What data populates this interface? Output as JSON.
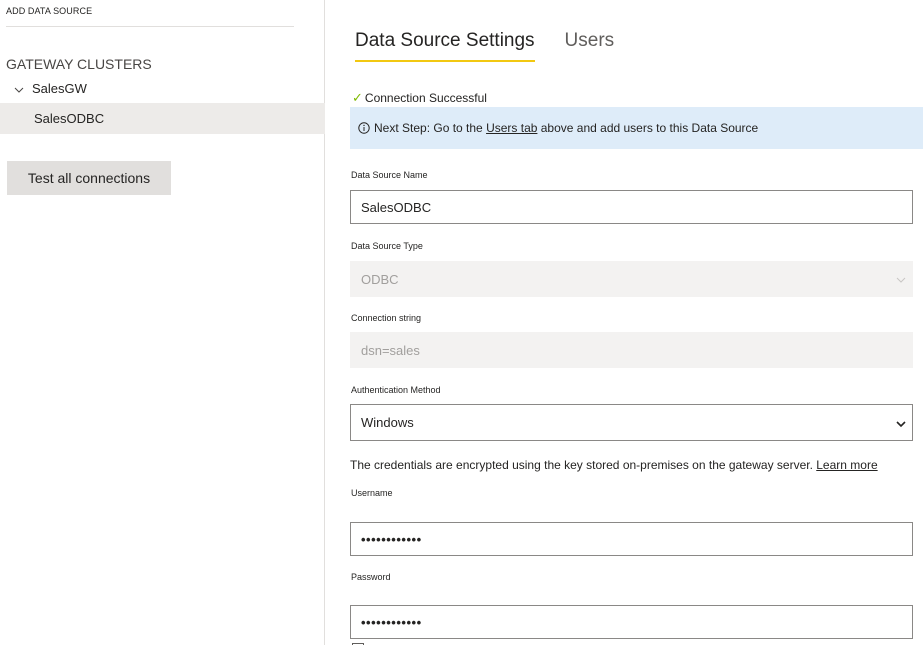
{
  "left_panel": {
    "add_data_source_label": "ADD DATA SOURCE",
    "gateway_clusters_title": "GATEWAY CLUSTERS",
    "cluster_name": "SalesGW",
    "data_source_item": "SalesODBC",
    "test_all_button": "Test all connections"
  },
  "tabs": {
    "settings": "Data Source Settings",
    "users": "Users"
  },
  "status": {
    "check": "✓",
    "connection_text": "Connection Successful"
  },
  "info_bar": {
    "prefix": "Next Step: Go to the ",
    "link": "Users tab",
    "suffix": " above and add users to this Data Source"
  },
  "fields": {
    "name_label": "Data Source Name",
    "name_value": "SalesODBC",
    "type_label": "Data Source Type",
    "type_value": "ODBC",
    "conn_label": "Connection string",
    "conn_value": "dsn=sales",
    "auth_label": "Authentication Method",
    "auth_value": "Windows",
    "cred_note_prefix": "The credentials are encrypted using the key stored on-premises on the gateway server. ",
    "cred_note_link": "Learn more",
    "username_label": "Username",
    "username_value": "••••••••••••",
    "password_label": "Password",
    "password_value": "••••••••••••"
  },
  "colors": {
    "accent_tab_underline": "#f2c811",
    "info_background": "#deecf9",
    "success_check": "#7fba00",
    "selected_item_background": "#edebe9"
  }
}
